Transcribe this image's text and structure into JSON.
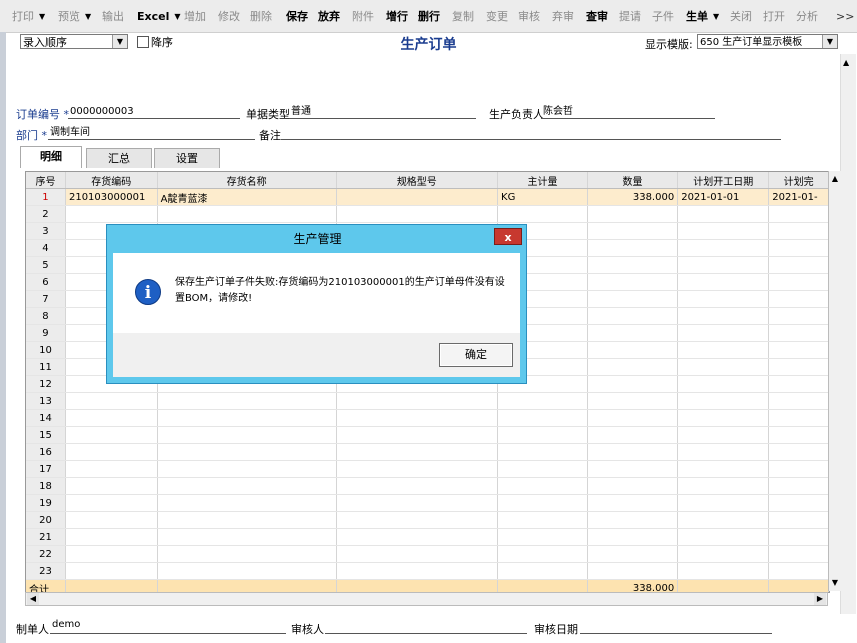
{
  "toolbar": {
    "buttons": [
      "打印",
      "预览",
      "输出",
      "Excel",
      "增加",
      "修改",
      "删除",
      "保存",
      "放弃",
      "附件",
      "增行",
      "删行",
      "复制",
      "变更",
      "审核",
      "弃审",
      "查审",
      "提请",
      "子件",
      "生单",
      "关闭",
      "打开",
      "分析"
    ],
    "more": ">>"
  },
  "header": {
    "order_by": "录入顺序",
    "desc_label": "降序",
    "title": "生产订单",
    "template_label": "显示模版:",
    "template_value": "650 生产订单显示模板"
  },
  "form": {
    "order_no_label": "订单编号",
    "order_no": "0000000003",
    "doc_type_label": "单据类型",
    "doc_type": "普通",
    "manager_label": "生产负责人",
    "manager": "陈会哲",
    "dept_label": "部门",
    "dept": "调制车间",
    "remark_label": "备注"
  },
  "tabs": [
    "明细",
    "汇总",
    "设置"
  ],
  "grid": {
    "columns": [
      "序号",
      "存货编码",
      "存货名称",
      "规格型号",
      "主计量",
      "数量",
      "计划开工日期",
      "计划完"
    ],
    "row1": {
      "no": "1",
      "code": "210103000001",
      "name": "A靛青蓝漆",
      "spec": "",
      "unit": "KG",
      "qty": "338.000",
      "start": "2021-01-01",
      "end": "2021-01-"
    },
    "row_numbers": [
      "2",
      "3",
      "4",
      "5",
      "6",
      "7",
      "8",
      "9",
      "10",
      "11",
      "12",
      "13",
      "14",
      "15",
      "16",
      "17",
      "18",
      "19",
      "20",
      "21",
      "22",
      "23"
    ],
    "total_label": "合计",
    "total_qty": "338.000"
  },
  "footer": {
    "maker_label": "制单人",
    "maker": "demo",
    "auditor_label": "审核人",
    "audit_date_label": "审核日期"
  },
  "dialog": {
    "title": "生产管理",
    "close": "x",
    "message": "保存生产订单子件失败:存货编码为210103000001的生产订单母件没有设置BOM，请修改!",
    "ok": "确定"
  }
}
